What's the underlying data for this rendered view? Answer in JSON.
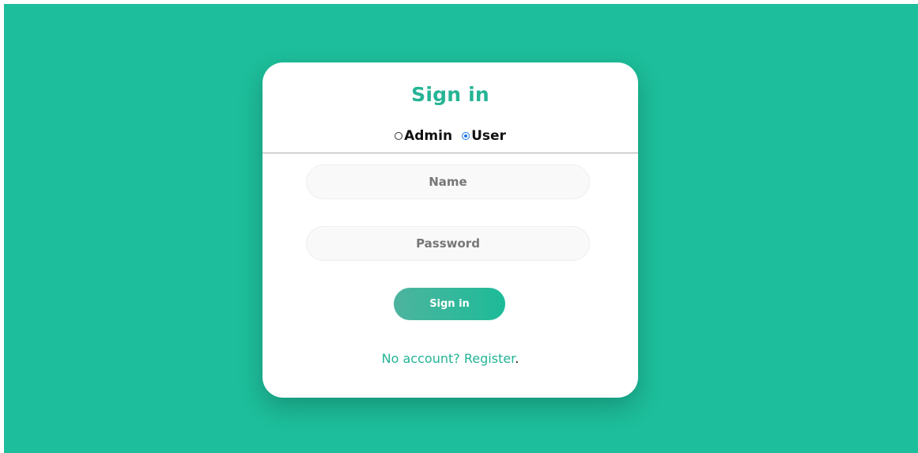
{
  "theme": {
    "background": "#1dbe9b",
    "card": "#ffffff",
    "accent": "#25b495",
    "divider": "#a9a9a9"
  },
  "form": {
    "title": "Sign in",
    "roles": [
      {
        "label": "Admin",
        "checked": false
      },
      {
        "label": "User",
        "checked": true
      }
    ],
    "name_placeholder": "Name",
    "password_placeholder": "Password",
    "submit_label": "Sign in",
    "register_text": "No account? Register",
    "register_suffix": "."
  }
}
